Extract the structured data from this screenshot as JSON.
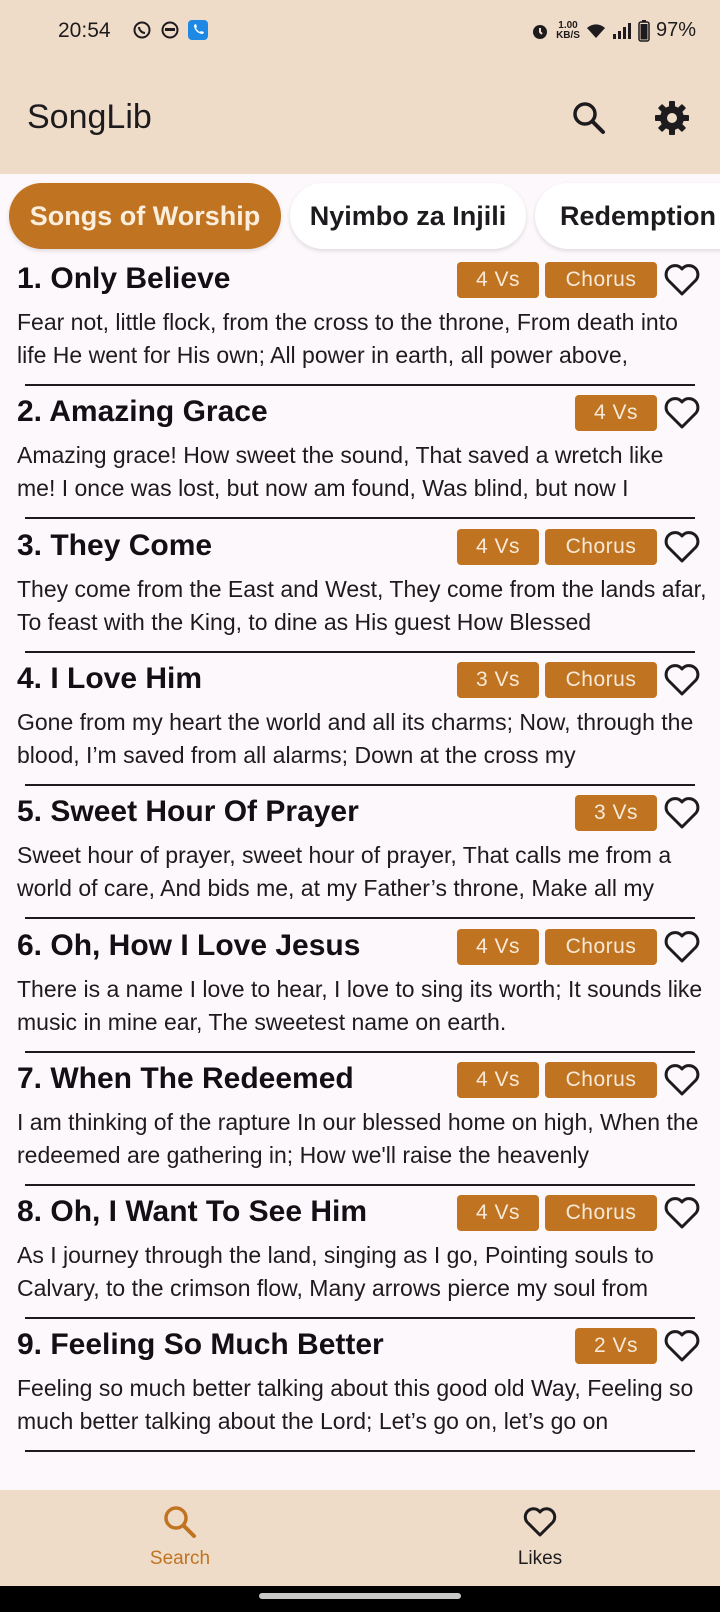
{
  "status_bar": {
    "time": "20:54",
    "net_speed_top": "1.00",
    "net_speed_bottom": "KB/S",
    "battery": "97%",
    "left_icons": [
      "whatsapp-icon",
      "face-icon",
      "phone-app-icon"
    ],
    "right_icons": [
      "alarm-icon",
      "wifi-icon",
      "signal-icon",
      "battery-icon"
    ]
  },
  "appbar": {
    "title": "SongLib",
    "search_icon": "search-icon",
    "settings_icon": "gear-icon"
  },
  "tabs": [
    {
      "label": "Songs of Worship",
      "active": true
    },
    {
      "label": "Nyimbo za Injili",
      "active": false
    },
    {
      "label": "Redemption",
      "active": false
    }
  ],
  "songs": [
    {
      "title": "1. Only Believe",
      "verses": "4 Vs",
      "chorus": "Chorus",
      "preview": "Fear not, little flock, from the cross to the throne, From death into life He went for His own; All power in earth, all power above,"
    },
    {
      "title": "2. Amazing Grace",
      "verses": "4 Vs",
      "chorus": "",
      "preview": "Amazing grace! How sweet the sound, That saved a wretch like me! I once was lost, but now am found, Was blind, but now I"
    },
    {
      "title": "3. They Come",
      "verses": "4 Vs",
      "chorus": "Chorus",
      "preview": "They come from the East and West, They come from the lands afar, To feast with the King, to dine as His guest How Blessed"
    },
    {
      "title": "4. I Love Him",
      "verses": "3 Vs",
      "chorus": "Chorus",
      "preview": "Gone from my heart the world and all its charms; Now, through the blood, I’m saved from all alarms; Down at the cross my"
    },
    {
      "title": "5. Sweet Hour Of Prayer",
      "verses": "3 Vs",
      "chorus": "",
      "preview": "Sweet hour of prayer, sweet hour of prayer, That calls me from a world of care, And bids me, at my Father’s throne, Make all my"
    },
    {
      "title": "6. Oh, How I Love Jesus",
      "verses": "4 Vs",
      "chorus": "Chorus",
      "preview": "There is a name I love to hear, I love to sing its worth; It sounds like music in mine ear, The sweetest name on earth."
    },
    {
      "title": "7. When The Redeemed",
      "verses": "4 Vs",
      "chorus": "Chorus",
      "preview": "I am thinking of the rapture In our blessed home on high, When the redeemed are gathering in; How we'll raise the heavenly"
    },
    {
      "title": "8. Oh, I Want To See Him",
      "verses": "4 Vs",
      "chorus": "Chorus",
      "preview": "As I journey through the land, singing as I go, Pointing souls to Calvary, to the crimson flow, Many arrows pierce my soul from"
    },
    {
      "title": "9. Feeling So Much Better",
      "verses": "2 Vs",
      "chorus": "",
      "preview": "Feeling so much better talking about this good old Way, Feeling so much better talking about the Lord; Let’s go on, let’s go on"
    }
  ],
  "bottom_nav": [
    {
      "label": "Search",
      "icon": "search-icon",
      "active": true
    },
    {
      "label": "Likes",
      "icon": "heart-icon",
      "active": false
    }
  ],
  "colors": {
    "accent": "#c07421",
    "bar_background": "#efdcc8",
    "page_background": "#fdf8fb"
  }
}
